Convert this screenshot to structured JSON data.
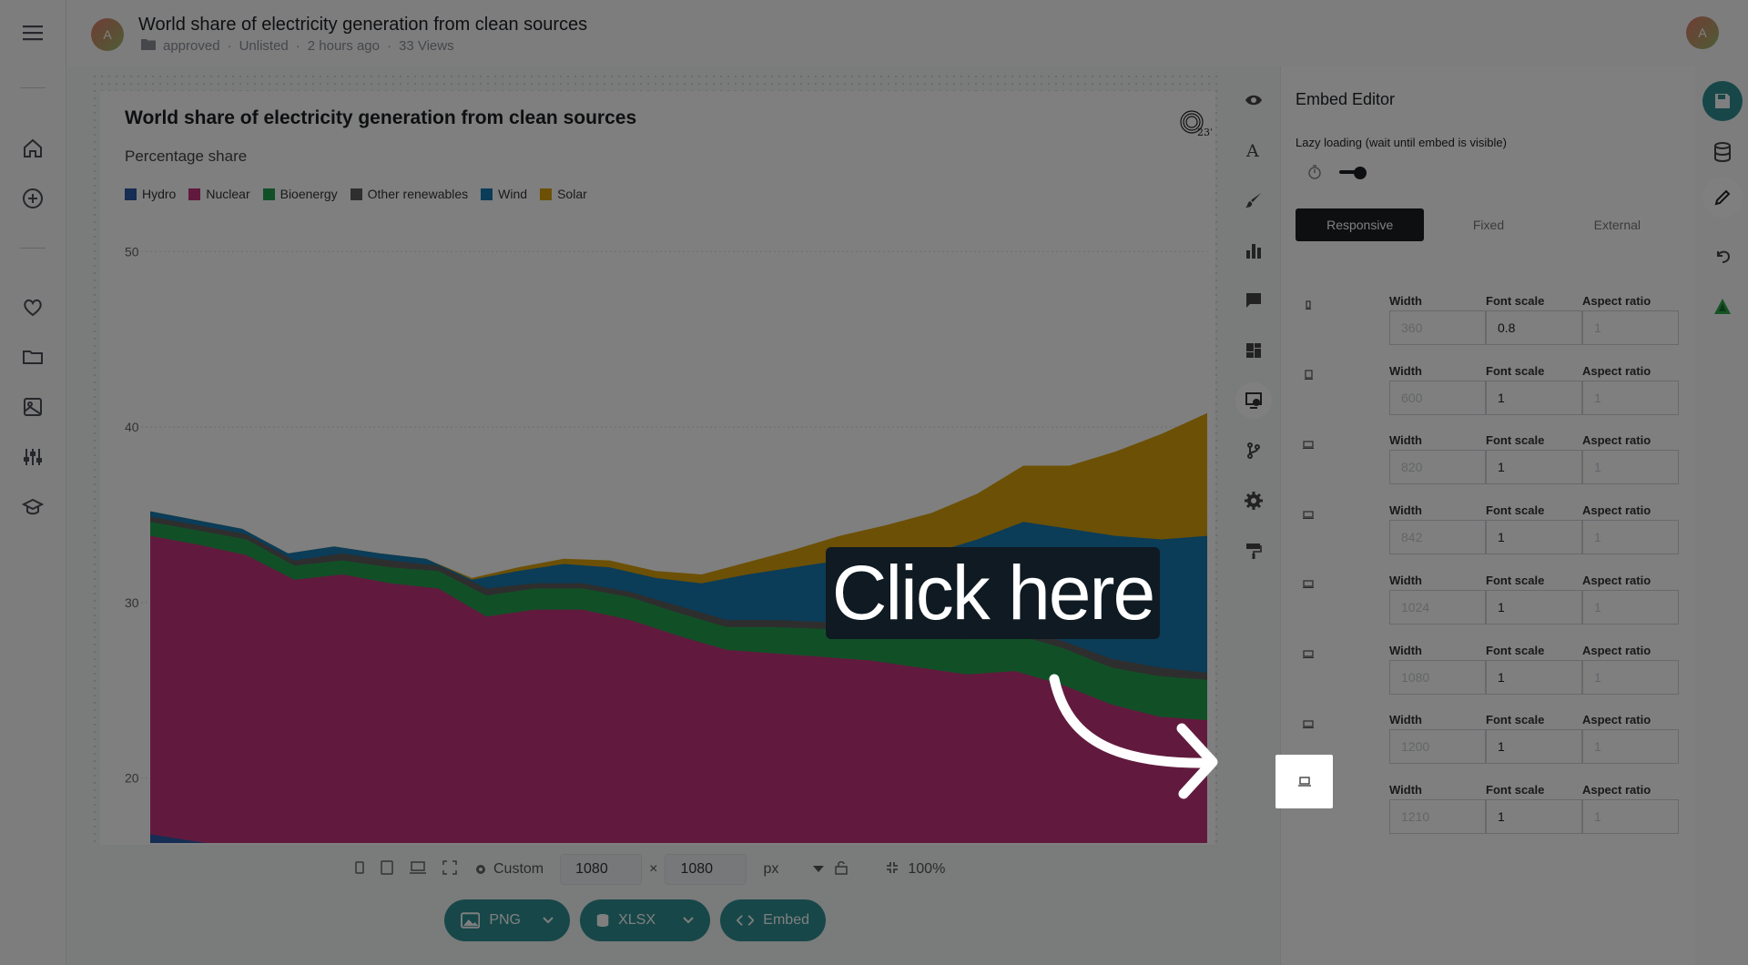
{
  "header": {
    "avatar_letter": "A",
    "title": "World share of electricity generation from clean sources",
    "folder": "approved",
    "visibility": "Unlisted",
    "updated": "2 hours ago",
    "views": "33 Views",
    "user_avatar_letter": "A"
  },
  "left_nav": {
    "items": [
      "menu-icon",
      "home-icon",
      "add-icon",
      "favorites-icon",
      "folder-icon",
      "images-icon",
      "tune-icon",
      "learn-icon"
    ]
  },
  "chart": {
    "title": "World share of electricity generation from clean sources",
    "subtitle": "Percentage share",
    "legend": [
      {
        "name": "Hydro",
        "color": "#2c5aa8"
      },
      {
        "name": "Nuclear",
        "color": "#c2347a"
      },
      {
        "name": "Bioenergy",
        "color": "#23a04f"
      },
      {
        "name": "Other renewables",
        "color": "#5c5c5c"
      },
      {
        "name": "Wind",
        "color": "#1679b0"
      },
      {
        "name": "Solar",
        "color": "#d8a10a"
      }
    ],
    "logo_text": "23°"
  },
  "chart_data": {
    "type": "area",
    "title": "World share of electricity generation from clean sources",
    "subtitle": "Percentage share",
    "y_ticks": [
      "50",
      "40",
      "30",
      "20"
    ],
    "ylim": [
      16.3,
      51
    ],
    "x_points": 20,
    "series": [
      {
        "name": "Hydro",
        "color": "#2c5aa8",
        "values": [
          16.8,
          16.3,
          16.3,
          16.3,
          16.3,
          16.3,
          16.3,
          16.3,
          16.3,
          16.3,
          16.3,
          16.3,
          16.3,
          16.3,
          16.3,
          16.3,
          16.3,
          16.3,
          16.3,
          16.3
        ]
      },
      {
        "name": "Nuclear",
        "color": "#c2347a",
        "values": [
          33.8,
          33.3,
          32.7,
          31.3,
          31.6,
          31.1,
          30.8,
          29.2,
          29.6,
          29.6,
          29.0,
          28.1,
          27.3,
          27.1,
          26.9,
          26.7,
          26.3,
          25.9,
          26.1,
          25.3,
          24.2,
          23.5,
          23.3
        ]
      },
      {
        "name": "Bioenergy",
        "color": "#23a04f",
        "values": [
          34.6,
          34.1,
          33.6,
          32.1,
          32.4,
          32.0,
          31.8,
          30.4,
          30.8,
          30.8,
          30.3,
          29.4,
          28.6,
          28.6,
          28.5,
          28.4,
          28.2,
          27.9,
          28.2,
          27.4,
          26.3,
          25.8,
          25.6
        ]
      },
      {
        "name": "Other renewables",
        "color": "#5c5c5c",
        "values": [
          34.9,
          34.4,
          33.9,
          32.4,
          32.8,
          32.4,
          32.1,
          30.8,
          31.1,
          31.1,
          30.6,
          29.8,
          29.0,
          29.0,
          28.9,
          28.8,
          28.6,
          28.4,
          28.6,
          27.8,
          26.8,
          26.3,
          26.0
        ]
      },
      {
        "name": "Wind",
        "color": "#1679b0",
        "values": [
          35.2,
          34.7,
          34.2,
          32.8,
          33.2,
          32.8,
          32.5,
          31.3,
          31.8,
          32.2,
          32.0,
          31.4,
          31.1,
          31.6,
          32.0,
          32.4,
          32.6,
          32.8,
          33.6,
          34.6,
          34.2,
          33.8,
          33.6,
          33.8
        ]
      },
      {
        "name": "Solar",
        "color": "#d8a10a",
        "values": [
          35.2,
          34.7,
          34.2,
          32.8,
          33.2,
          32.8,
          32.5,
          31.4,
          32.0,
          32.5,
          32.4,
          31.8,
          31.6,
          32.3,
          33.0,
          33.8,
          34.4,
          35.1,
          36.2,
          37.8,
          37.8,
          38.6,
          39.6,
          40.8
        ]
      }
    ]
  },
  "bottom_toolbar": {
    "preset": "Custom",
    "width": "1080",
    "times": "×",
    "height": "1080",
    "unit": "px",
    "zoom": "100%"
  },
  "export": {
    "png": "PNG",
    "xlsx": "XLSX",
    "embed": "Embed"
  },
  "embed_editor": {
    "title": "Embed Editor",
    "lazy_label": "Lazy loading (wait until embed is visible)",
    "tabs": [
      "Responsive",
      "Fixed",
      "External"
    ],
    "col_width": "Width",
    "col_font": "Font scale",
    "col_aspect": "Aspect ratio",
    "breakpoints": [
      {
        "width_ph": "360",
        "font": "0.8",
        "aspect_ph": "1"
      },
      {
        "width_ph": "600",
        "font": "1",
        "aspect_ph": "1"
      },
      {
        "width_ph": "820",
        "font": "1",
        "aspect_ph": "1"
      },
      {
        "width_ph": "842",
        "font": "1",
        "aspect_ph": "1"
      },
      {
        "width_ph": "1024",
        "font": "1",
        "aspect_ph": "1"
      },
      {
        "width_ph": "1080",
        "font": "1",
        "aspect_ph": "1"
      },
      {
        "width_ph": "1200",
        "font": "1",
        "aspect_ph": "1"
      },
      {
        "width_ph": "1210",
        "font": "1",
        "aspect_ph": "1"
      }
    ]
  },
  "tutorial": {
    "callout": "Click here"
  }
}
